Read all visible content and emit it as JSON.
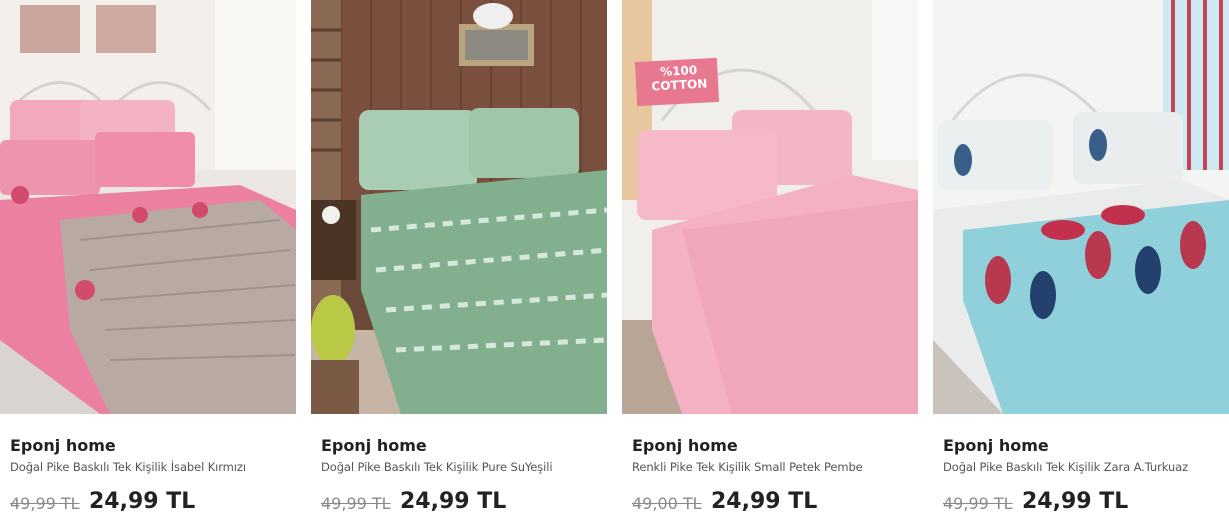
{
  "products": [
    {
      "brand": "Eponj home",
      "name": "Doğal Pike Baskılı Tek Kişilik İsabel Kırmızı",
      "old_price": "49,99 TL",
      "price": "24,99 TL",
      "image": "pink-floral-bedspread-photo"
    },
    {
      "brand": "Eponj home",
      "name": "Doğal Pike Baskılı Tek Kişilik Pure SuYeşili",
      "old_price": "49,99 TL",
      "price": "24,99 TL",
      "image": "green-damask-bedspread-photo"
    },
    {
      "brand": "Eponj home",
      "name": "Renkli Pike Tek Kişilik Small Petek Pembe",
      "old_price": "49,00 TL",
      "price": "24,99 TL",
      "image": "pink-plain-bedspread-photo",
      "image_badge": "%100 COTTON"
    },
    {
      "brand": "Eponj home",
      "name": "Doğal Pike Baskılı Tek Kişilik Zara A.Turkuaz",
      "old_price": "49,99 TL",
      "price": "24,99 TL",
      "image": "turquoise-paisley-bedspread-photo"
    }
  ]
}
